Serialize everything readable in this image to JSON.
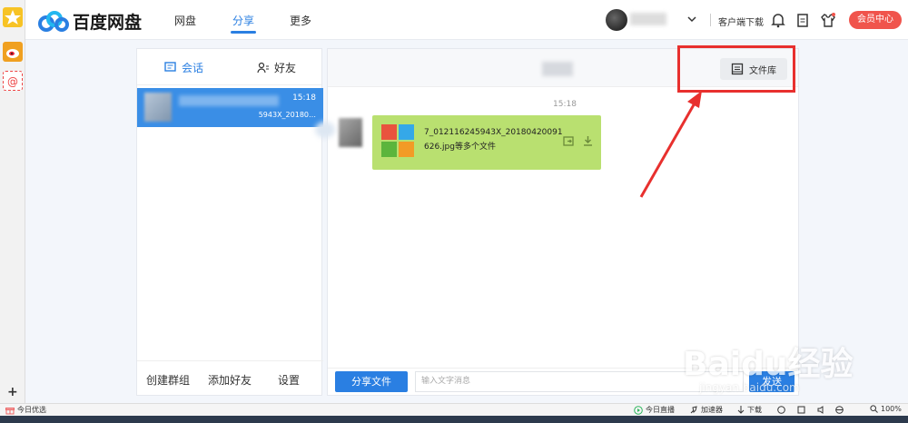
{
  "header": {
    "logo_text": "百度网盘",
    "nav": [
      "网盘",
      "分享",
      "更多"
    ],
    "client_download": "客户端下载",
    "vip_label": "会员中心"
  },
  "left_panel": {
    "tabs": [
      "会话",
      "好友"
    ],
    "conversation": {
      "time": "15:18",
      "preview": "5943X_20180…"
    },
    "footer": [
      "创建群组",
      "添加好友",
      "设置"
    ]
  },
  "chat": {
    "library_label": "文件库",
    "time": "15:18",
    "message_line1": "7_012116245943X_20180420091",
    "message_line2": "626.jpg等多个文件",
    "share_button": "分享文件",
    "input_placeholder": "输入文字消息",
    "send_button": "发送"
  },
  "statusbar": {
    "left": "今日优选",
    "live": "今日直播",
    "accelerator": "加速器",
    "download": "下载",
    "zoom": "100%"
  },
  "watermark": {
    "brand": "Baidu经验",
    "url": "jingyan.baidu.com"
  },
  "colors": {
    "accent": "#2a7fe2",
    "vip": "#f0544c",
    "bubble": "#b9e070",
    "annotation": "#e8302e"
  }
}
